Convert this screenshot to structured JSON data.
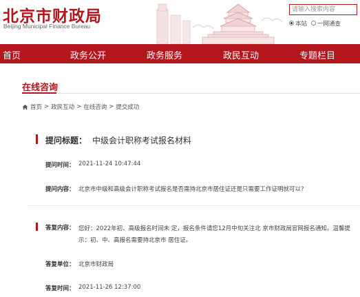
{
  "header": {
    "logo_cn": "北京市财政局",
    "logo_en": "Beijing Municipal Finance Bureau",
    "search_placeholder": "请输入搜索内容",
    "search_opt_site": "本站",
    "search_opt_all": "一网通查"
  },
  "nav": {
    "items": [
      "首页",
      "政务公开",
      "政务服务",
      "政民互动",
      "专题栏目"
    ]
  },
  "section": {
    "title": "在线咨询"
  },
  "breadcrumb": {
    "items": [
      "首页",
      ">",
      "政民互动",
      ">",
      "在线咨询",
      ">",
      "提交成功"
    ]
  },
  "question": {
    "title_label": "提问标题：",
    "title_value": "中级会计职称考试报名材料",
    "time_label": "提问时间：",
    "time_value": "2021-11-24 10:47:44",
    "content_label": "提问内容：",
    "content_value": "北京市中级和高级会计职称考试报名是否需持北京市居住证还是只需要工作证明就可以?"
  },
  "answer": {
    "content_label": "答复内容：",
    "content_value": "您好：2022年初、高级报名时间未 定，报名条件请您12月中旬关注北 京市财政局官网报名通知。温馨提 示：初、中、高报名需要持北京市 居住证。",
    "unit_label": "答复单位：",
    "unit_value": "北京市财政局",
    "time_label": "答复时间：",
    "time_value": "2021-11-26 12:37:00"
  },
  "colors": {
    "brand_red": "#b3161c"
  }
}
